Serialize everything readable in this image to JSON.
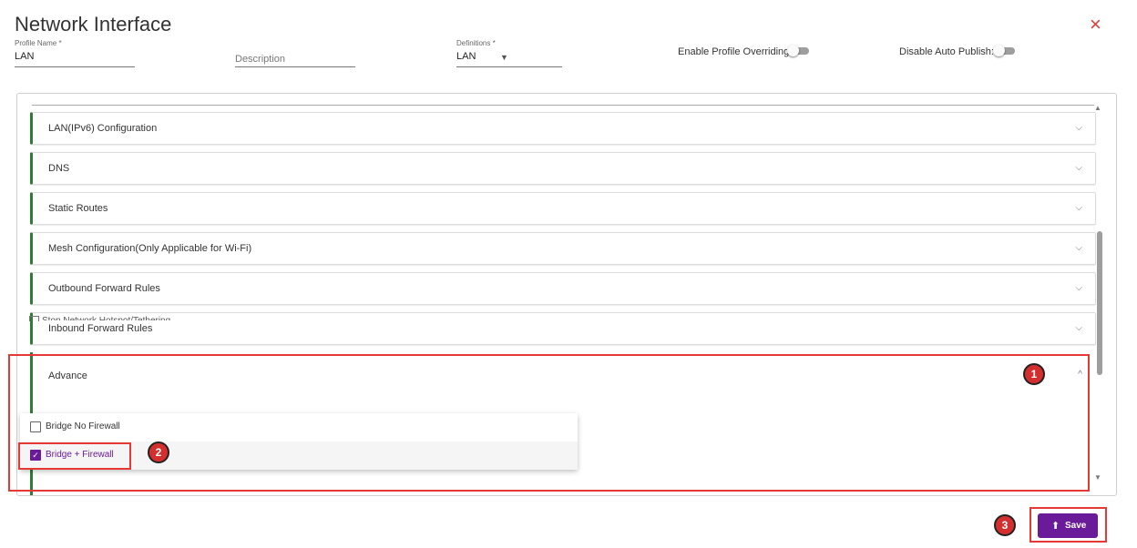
{
  "dialog": {
    "title": "Network Interface",
    "close_icon": "×"
  },
  "form": {
    "profile_name": {
      "label": "Profile Name *",
      "value": "LAN"
    },
    "description": {
      "placeholder": "Description"
    },
    "definitions": {
      "label": "Definitions *",
      "value": "LAN"
    },
    "enable_profile_overriding": {
      "label": "Enable Profile Overriding:",
      "on": false
    },
    "disable_auto_publish": {
      "label": "Disable Auto Publish:",
      "on": false
    }
  },
  "sections": [
    {
      "label": "LAN(IPv6) Configuration"
    },
    {
      "label": "DNS"
    },
    {
      "label": "Static Routes"
    },
    {
      "label": "Mesh Configuration(Only Applicable for Wi-Fi)"
    },
    {
      "label": "Outbound Forward Rules"
    },
    {
      "label": "Inbound Forward Rules"
    }
  ],
  "advance": {
    "label": "Advance",
    "partial_text": "Stop Network Hotspot/Tethering"
  },
  "dropdown": {
    "options": [
      {
        "label": "Bridge No Firewall",
        "checked": false
      },
      {
        "label": "Bridge + Firewall",
        "checked": true
      }
    ]
  },
  "annotations": {
    "one": "1",
    "two": "2",
    "three": "3"
  },
  "save_button": {
    "label": "Save",
    "icon": "upload-icon"
  },
  "colors": {
    "accent": "#6a1b9a",
    "section_border": "#2e7d32",
    "highlight": "#e53935"
  }
}
